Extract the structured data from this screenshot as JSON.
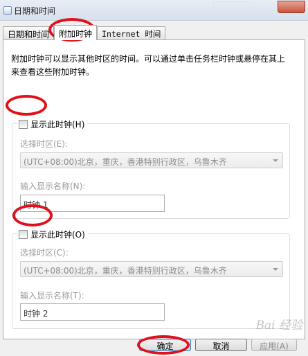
{
  "window": {
    "title": "日期和时间"
  },
  "tabs": [
    {
      "label": "日期和时间"
    },
    {
      "label": "附加时钟"
    },
    {
      "label": "Internet 时间"
    }
  ],
  "description": "附加时钟可以显示其他时区的时间。可以通过单击任务栏时钟或悬停在其上来查看这些附加时钟。",
  "clock1": {
    "checkbox_label": "显示此时钟(H)",
    "checked": false,
    "timezone_label": "选择时区(E):",
    "timezone_value": "(UTC+08:00)北京，重庆，香港特别行政区，乌鲁木齐",
    "name_label": "输入显示名称(N):",
    "name_value": "时钟 1"
  },
  "clock2": {
    "checkbox_label": "显示此时钟(O)",
    "checked": false,
    "timezone_label": "选择时区(C):",
    "timezone_value": "(UTC+08:00)北京，重庆，香港特别行政区，乌鲁木齐",
    "name_label": "输入显示名称(T):",
    "name_value": "时钟 2"
  },
  "buttons": {
    "ok": "确定",
    "cancel": "取消",
    "apply": "应用(A)"
  },
  "annotation_color": "#e0111a",
  "watermark": "Bai 经验"
}
